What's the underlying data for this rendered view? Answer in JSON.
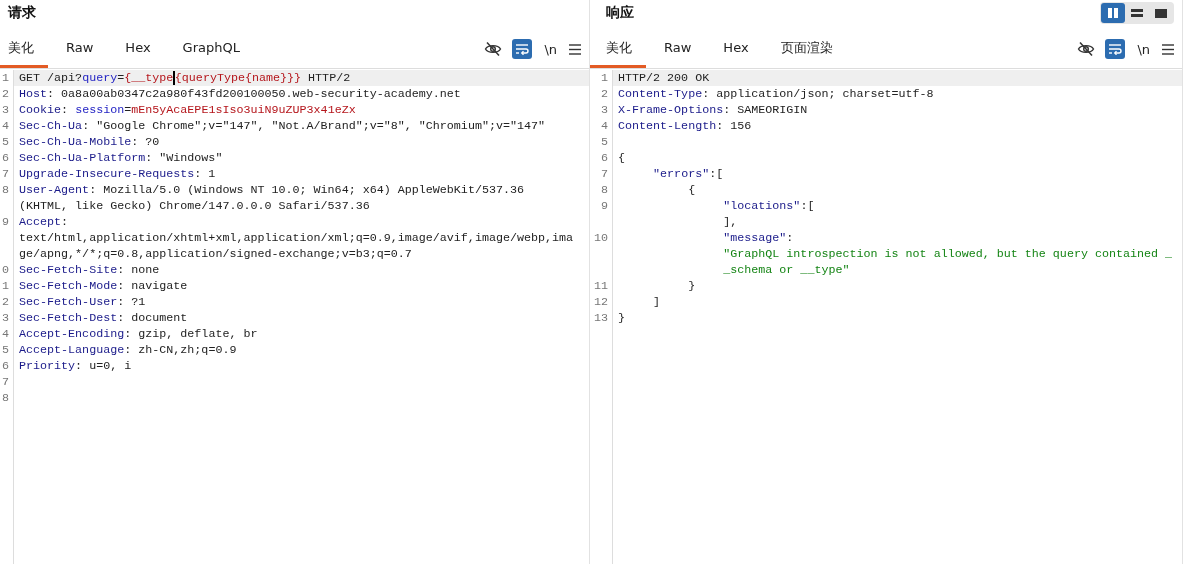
{
  "panels": [
    {
      "title": "请求",
      "tabs": [
        {
          "label": "美化",
          "selected": true
        },
        {
          "label": "Raw",
          "selected": false
        },
        {
          "label": "Hex",
          "selected": false
        },
        {
          "label": "GraphQL",
          "selected": false
        }
      ],
      "wrap_on": true,
      "newline_label": "\\n",
      "lines": [
        {
          "number": "1",
          "current": true,
          "rows": [
            [
              {
                "kind": "plain",
                "text": "GET /api?"
              },
              {
                "kind": "param",
                "text": "query"
              },
              {
                "kind": "plain",
                "text": "="
              },
              {
                "kind": "value",
                "text": "{__type",
                "cursor": true
              },
              {
                "kind": "value",
                "text": "{queryType{name}}}"
              },
              {
                "kind": "plain",
                "text": " HTTP/2"
              }
            ]
          ]
        },
        {
          "number": "2",
          "current": false,
          "rows": [
            [
              {
                "kind": "header",
                "text": "Host"
              },
              {
                "kind": "plain",
                "text": ": 0a8a00ab0347c2a980f43fd200100050.web-security-academy.net"
              }
            ]
          ]
        },
        {
          "number": "3",
          "current": false,
          "rows": [
            [
              {
                "kind": "header",
                "text": "Cookie"
              },
              {
                "kind": "plain",
                "text": ": "
              },
              {
                "kind": "param",
                "text": "session"
              },
              {
                "kind": "plain",
                "text": "="
              },
              {
                "kind": "value",
                "text": "mEn5yAcaEPE1sIso3uiN9uZUP3x41eZx"
              }
            ]
          ]
        },
        {
          "number": "4",
          "current": false,
          "rows": [
            [
              {
                "kind": "header",
                "text": "Sec-Ch-Ua"
              },
              {
                "kind": "plain",
                "text": ": \"Google Chrome\";v=\"147\", \"Not.A/Brand\";v=\"8\", \"Chromium\";v=\"147\""
              }
            ]
          ]
        },
        {
          "number": "5",
          "current": false,
          "rows": [
            [
              {
                "kind": "header",
                "text": "Sec-Ch-Ua-Mobile"
              },
              {
                "kind": "plain",
                "text": ": ?0"
              }
            ]
          ]
        },
        {
          "number": "6",
          "current": false,
          "rows": [
            [
              {
                "kind": "header",
                "text": "Sec-Ch-Ua-Platform"
              },
              {
                "kind": "plain",
                "text": ": \"Windows\""
              }
            ]
          ]
        },
        {
          "number": "7",
          "current": false,
          "rows": [
            [
              {
                "kind": "header",
                "text": "Upgrade-Insecure-Requests"
              },
              {
                "kind": "plain",
                "text": ": 1"
              }
            ]
          ]
        },
        {
          "number": "8",
          "current": false,
          "rows": [
            [
              {
                "kind": "header",
                "text": "User-Agent"
              },
              {
                "kind": "plain",
                "text": ": Mozilla/5.0 (Windows NT 10.0; Win64; x64) AppleWebKit/537.36"
              }
            ],
            [
              {
                "kind": "plain",
                "text": "(KHTML, like Gecko) Chrome/147.0.0.0 Safari/537.36"
              }
            ]
          ]
        },
        {
          "number": "9",
          "current": false,
          "rows": [
            [
              {
                "kind": "header",
                "text": "Accept"
              },
              {
                "kind": "plain",
                "text": ":"
              }
            ],
            [
              {
                "kind": "plain",
                "text": "text/html,application/xhtml+xml,application/xml;q=0.9,image/avif,image/webp,ima"
              }
            ],
            [
              {
                "kind": "plain",
                "text": "ge/apng,*/*;q=0.8,application/signed-exchange;v=b3;q=0.7"
              }
            ]
          ]
        },
        {
          "number": "0",
          "current": false,
          "rows": [
            [
              {
                "kind": "header",
                "text": "Sec-Fetch-Site"
              },
              {
                "kind": "plain",
                "text": ": none"
              }
            ]
          ]
        },
        {
          "number": "1",
          "current": false,
          "rows": [
            [
              {
                "kind": "header",
                "text": "Sec-Fetch-Mode"
              },
              {
                "kind": "plain",
                "text": ": navigate"
              }
            ]
          ]
        },
        {
          "number": "2",
          "current": false,
          "rows": [
            [
              {
                "kind": "header",
                "text": "Sec-Fetch-User"
              },
              {
                "kind": "plain",
                "text": ": ?1"
              }
            ]
          ]
        },
        {
          "number": "3",
          "current": false,
          "rows": [
            [
              {
                "kind": "header",
                "text": "Sec-Fetch-Dest"
              },
              {
                "kind": "plain",
                "text": ": document"
              }
            ]
          ]
        },
        {
          "number": "4",
          "current": false,
          "rows": [
            [
              {
                "kind": "header",
                "text": "Accept-Encoding"
              },
              {
                "kind": "plain",
                "text": ": gzip, deflate, br"
              }
            ]
          ]
        },
        {
          "number": "5",
          "current": false,
          "rows": [
            [
              {
                "kind": "header",
                "text": "Accept-Language"
              },
              {
                "kind": "plain",
                "text": ": zh-CN,zh;q=0.9"
              }
            ]
          ]
        },
        {
          "number": "6",
          "current": false,
          "rows": [
            [
              {
                "kind": "header",
                "text": "Priority"
              },
              {
                "kind": "plain",
                "text": ": u=0, i"
              }
            ]
          ]
        },
        {
          "number": "7",
          "current": false,
          "rows": [
            []
          ]
        },
        {
          "number": "8",
          "current": false,
          "rows": [
            []
          ]
        }
      ]
    },
    {
      "title": "响应",
      "tabs": [
        {
          "label": "美化",
          "selected": true
        },
        {
          "label": "Raw",
          "selected": false
        },
        {
          "label": "Hex",
          "selected": false
        },
        {
          "label": "页面渲染",
          "selected": false
        }
      ],
      "view_modes": [
        {
          "kind": "columns",
          "selected": true
        },
        {
          "kind": "rows",
          "selected": false
        },
        {
          "kind": "single",
          "selected": false
        }
      ],
      "wrap_on": true,
      "newline_label": "\\n",
      "lines": [
        {
          "number": "1",
          "current": true,
          "rows": [
            [
              {
                "kind": "plain",
                "text": "HTTP/2 200 OK"
              }
            ]
          ]
        },
        {
          "number": "2",
          "current": false,
          "rows": [
            [
              {
                "kind": "header",
                "text": "Content-Type"
              },
              {
                "kind": "plain",
                "text": ": application/json; charset=utf-8"
              }
            ]
          ]
        },
        {
          "number": "3",
          "current": false,
          "rows": [
            [
              {
                "kind": "header",
                "text": "X-Frame-Options"
              },
              {
                "kind": "plain",
                "text": ": SAMEORIGIN"
              }
            ]
          ]
        },
        {
          "number": "4",
          "current": false,
          "rows": [
            [
              {
                "kind": "header",
                "text": "Content-Length"
              },
              {
                "kind": "plain",
                "text": ": 156"
              }
            ]
          ]
        },
        {
          "number": "5",
          "current": false,
          "rows": [
            []
          ]
        },
        {
          "number": "6",
          "current": false,
          "rows": [
            [
              {
                "kind": "plain",
                "text": "{"
              }
            ]
          ]
        },
        {
          "number": "7",
          "current": false,
          "rows": [
            [
              {
                "kind": "plain",
                "text": "     "
              },
              {
                "kind": "header",
                "text": "\"errors\""
              },
              {
                "kind": "plain",
                "text": ":["
              }
            ]
          ]
        },
        {
          "number": "8",
          "current": false,
          "rows": [
            [
              {
                "kind": "plain",
                "text": "          {"
              }
            ]
          ]
        },
        {
          "number": "9",
          "current": false,
          "rows": [
            [
              {
                "kind": "plain",
                "text": "               "
              },
              {
                "kind": "header",
                "text": "\"locations\""
              },
              {
                "kind": "plain",
                "text": ":["
              }
            ],
            [
              {
                "kind": "plain",
                "text": "               ],"
              }
            ]
          ]
        },
        {
          "number": "10",
          "current": false,
          "rows": [
            [
              {
                "kind": "plain",
                "text": "               "
              },
              {
                "kind": "header",
                "text": "\"message\""
              },
              {
                "kind": "plain",
                "text": ":"
              }
            ],
            [
              {
                "kind": "plain",
                "text": "               "
              },
              {
                "kind": "string",
                "text": "\"GraphQL introspection is not allowed, but the query contained _"
              }
            ],
            [
              {
                "kind": "plain",
                "text": "               "
              },
              {
                "kind": "string",
                "text": "_schema or __type\""
              }
            ]
          ]
        },
        {
          "number": "11",
          "current": false,
          "rows": [
            [
              {
                "kind": "plain",
                "text": "          }"
              }
            ]
          ]
        },
        {
          "number": "12",
          "current": false,
          "rows": [
            [
              {
                "kind": "plain",
                "text": "     ]"
              }
            ]
          ]
        },
        {
          "number": "13",
          "current": false,
          "rows": [
            [
              {
                "kind": "plain",
                "text": "}"
              }
            ]
          ]
        }
      ]
    }
  ]
}
